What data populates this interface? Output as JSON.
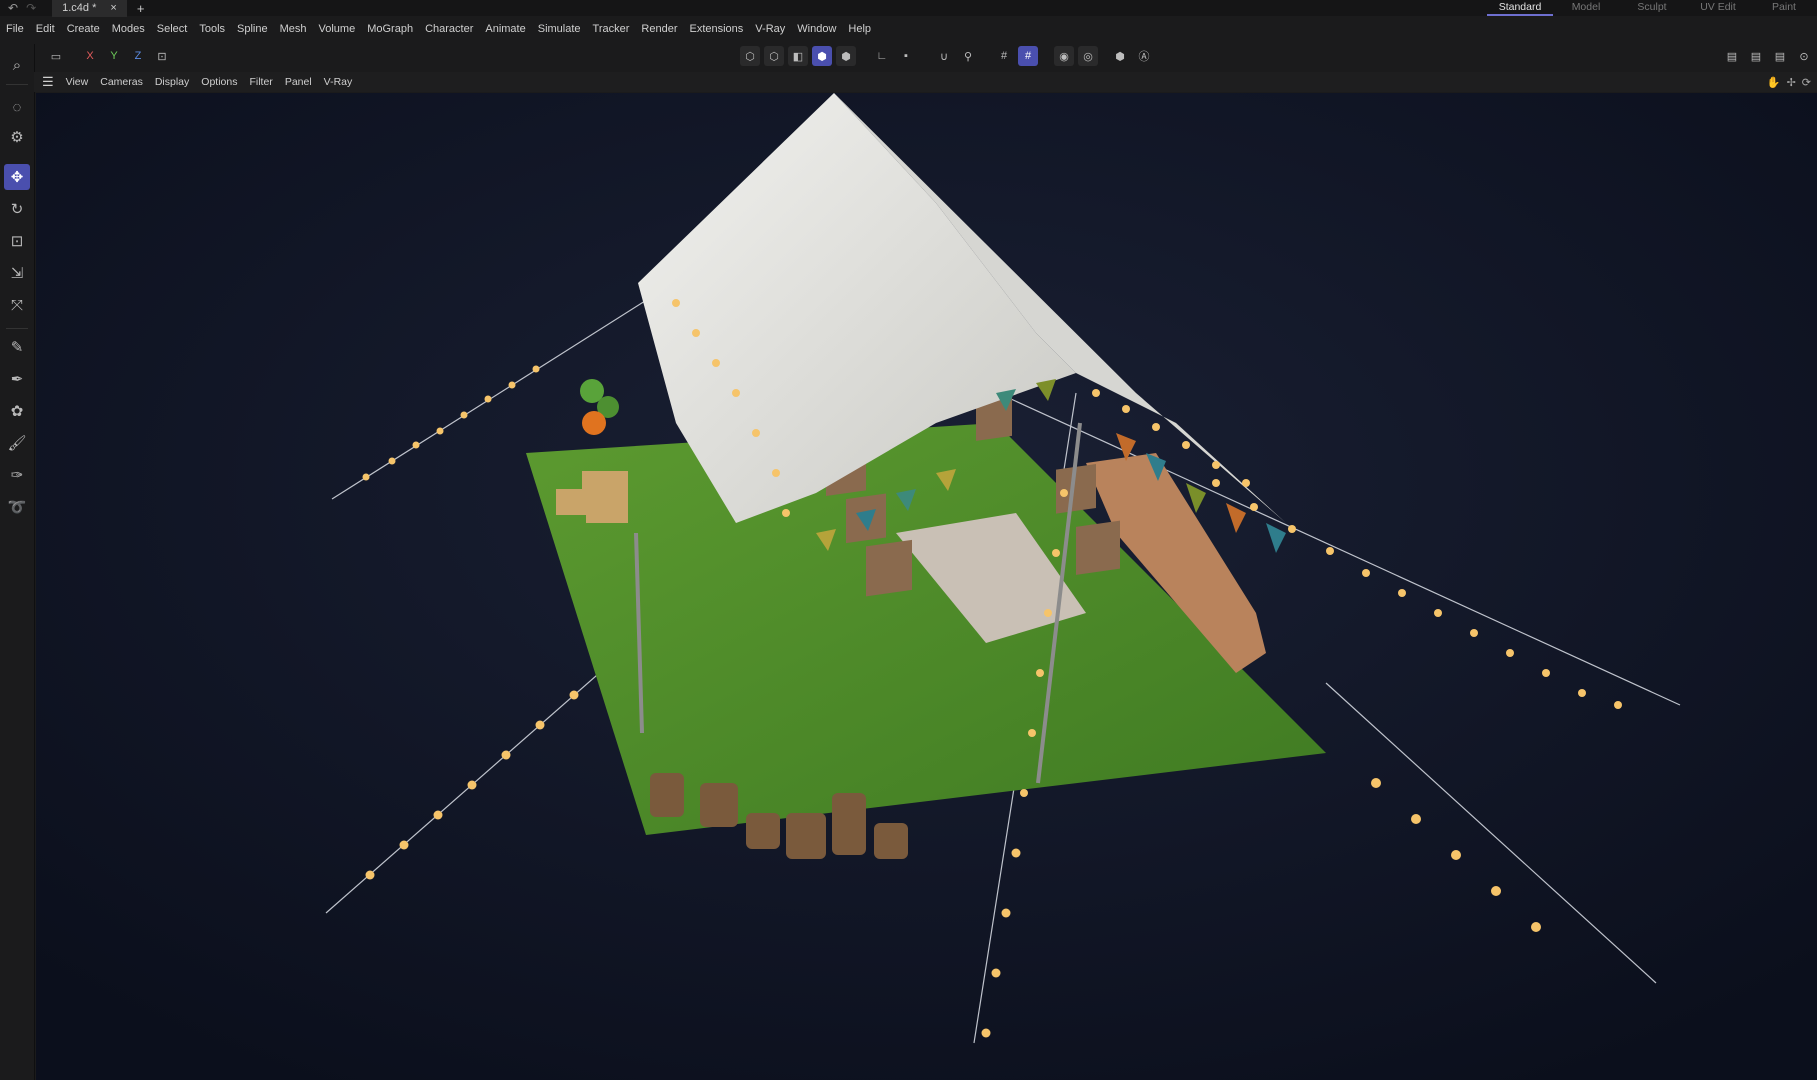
{
  "titlebar": {
    "undo_icon": "undo-icon",
    "redo_icon": "redo-icon",
    "document_tab": "1.c4d *",
    "close_glyph": "×",
    "add_glyph": "+"
  },
  "layouts": [
    "Standard",
    "Model",
    "Sculpt",
    "UV Edit",
    "Paint"
  ],
  "active_layout": "Standard",
  "menu": [
    "File",
    "Edit",
    "Create",
    "Modes",
    "Select",
    "Tools",
    "Spline",
    "Mesh",
    "Volume",
    "MoGraph",
    "Character",
    "Animate",
    "Simulate",
    "Tracker",
    "Render",
    "Extensions",
    "V-Ray",
    "Window",
    "Help"
  ],
  "toolbar": {
    "axis_x": "X",
    "axis_y": "Y",
    "axis_z": "Z"
  },
  "viewport_menu": [
    "View",
    "Cameras",
    "Display",
    "Options",
    "Filter",
    "Panel",
    "V-Ray"
  ],
  "colors": {
    "accent": "#4a4fae",
    "viewport_bg": "#0f1426",
    "grass": "#4f8a2a",
    "tent": "#e2e2de",
    "light_bulb": "#f6c46a"
  }
}
